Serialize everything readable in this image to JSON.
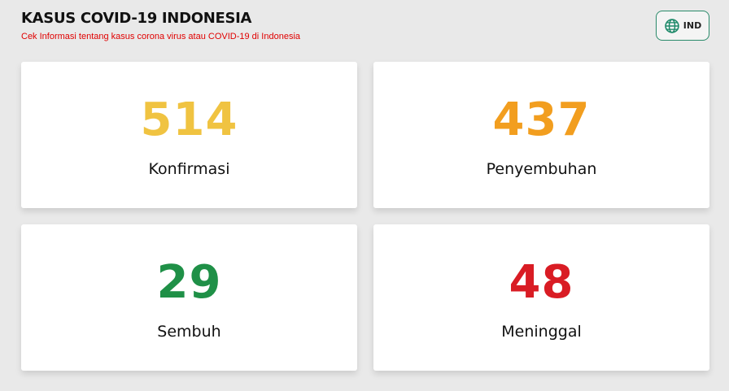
{
  "header": {
    "title": "KASUS COVID-19 INDONESIA",
    "subtitle": "Cek Informasi tentang kasus corona virus atau COVID-19 di Indonesia"
  },
  "language_button": {
    "icon": "globe-icon",
    "label": "IND",
    "border_color": "#2a8a6a"
  },
  "stats": [
    {
      "value": "514",
      "label": "Konfirmasi",
      "color": "#f0c341"
    },
    {
      "value": "437",
      "label": "Penyembuhan",
      "color": "#f29e1f"
    },
    {
      "value": "29",
      "label": "Sembuh",
      "color": "#1f9047"
    },
    {
      "value": "48",
      "label": "Meninggal",
      "color": "#d91c24"
    }
  ]
}
